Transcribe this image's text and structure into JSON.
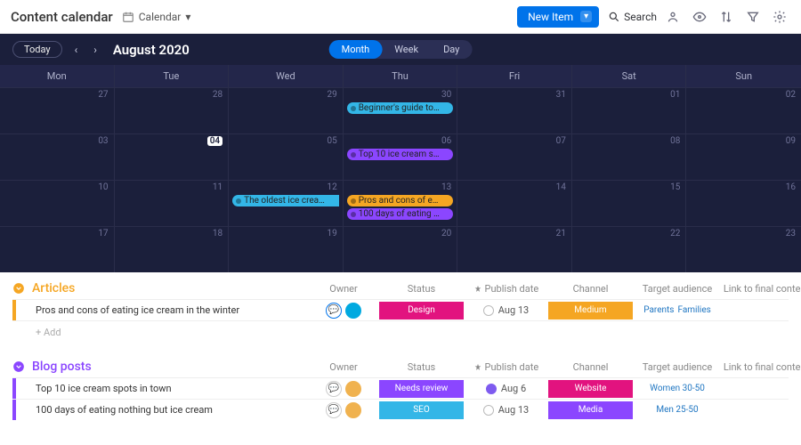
{
  "header": {
    "title": "Content calendar",
    "view_label": "Calendar",
    "new_item": "New Item",
    "search": "Search"
  },
  "calendar": {
    "today": "Today",
    "month_title": "August 2020",
    "ranges": [
      "Month",
      "Week",
      "Day"
    ],
    "active_range": "Month",
    "dow": [
      "Mon",
      "Tue",
      "Wed",
      "Thu",
      "Fri",
      "Sat",
      "Sun"
    ],
    "weeks": [
      {
        "days": [
          "27",
          "28",
          "29",
          "30",
          "31",
          "01",
          "02"
        ],
        "events": [
          {
            "col": 3,
            "label": "Beginner's guide to…",
            "color": "#33b6e7"
          }
        ]
      },
      {
        "days": [
          "03",
          "04",
          "05",
          "06",
          "07",
          "08",
          "09"
        ],
        "today_col": 1,
        "events": [
          {
            "col": 3,
            "label": "Top 10 ice cream s…",
            "color": "#8b46ff"
          }
        ]
      },
      {
        "days": [
          "10",
          "11",
          "12",
          "13",
          "14",
          "15",
          "16"
        ],
        "events": [
          {
            "col": 2,
            "label": "The oldest ice crea…",
            "color": "#33b6e7",
            "span": true
          },
          {
            "col": 3,
            "label": "Pros and cons of e…",
            "color": "#f5a623"
          },
          {
            "col": 3,
            "label": "100 days of eating …",
            "color": "#8b46ff",
            "second": true
          }
        ]
      },
      {
        "days": [
          "17",
          "18",
          "19",
          "20",
          "21",
          "22",
          "23"
        ],
        "events": []
      }
    ]
  },
  "groups": [
    {
      "title": "Articles",
      "color": "#f5a623",
      "columns": [
        "Owner",
        "Status",
        "Publish date",
        "Channel",
        "Target audience",
        "Link to final content"
      ],
      "rows": [
        {
          "name": "Pros and cons of eating ice cream in the winter",
          "chat_active": true,
          "avatar": "b",
          "status": {
            "label": "Design",
            "color": "#e2137f"
          },
          "date": "Aug 13",
          "date_filled": false,
          "channel": {
            "label": "Medium",
            "color": "#f5a623"
          },
          "audience": [
            "Parents",
            "Families"
          ]
        }
      ],
      "add": "+ Add"
    },
    {
      "title": "Blog posts",
      "color": "#8b46ff",
      "columns": [
        "Owner",
        "Status",
        "Publish date",
        "Channel",
        "Target audience",
        "Link to final content"
      ],
      "rows": [
        {
          "name": "Top 10 ice cream spots in town",
          "chat_active": false,
          "avatar": "a",
          "status": {
            "label": "Needs review",
            "color": "#8b46ff"
          },
          "date": "Aug 6",
          "date_filled": true,
          "channel": {
            "label": "Website",
            "color": "#e2137f"
          },
          "audience": [
            "Women 30-50"
          ]
        },
        {
          "name": "100 days of eating nothing but ice cream",
          "chat_active": false,
          "avatar": "a",
          "status": {
            "label": "SEO",
            "color": "#33b6e7"
          },
          "date": "Aug 13",
          "date_filled": false,
          "channel": {
            "label": "Media",
            "color": "#8b46ff"
          },
          "audience": [
            "Men 25-50"
          ]
        }
      ]
    }
  ]
}
